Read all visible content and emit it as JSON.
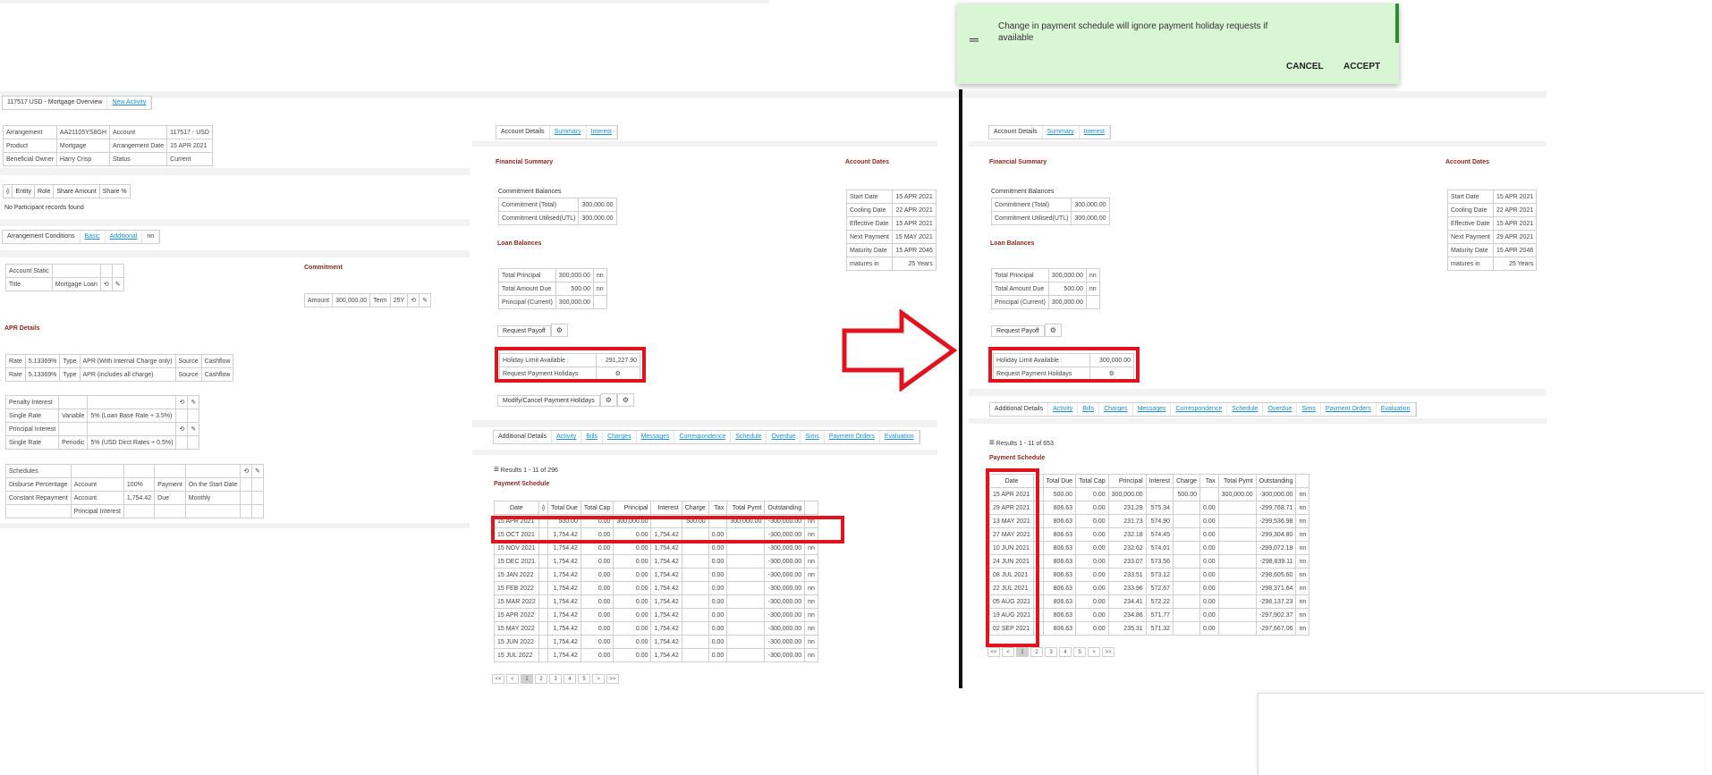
{
  "top_tabs": {
    "overview": "117517 USD - Mortgage Overview",
    "new_activity": "New Activity"
  },
  "arrangement": {
    "rows": [
      [
        "Arrangement",
        "AA21105YS8GH",
        "Account",
        "117517 - USD"
      ],
      [
        "Product",
        "Mortgage",
        "Arrangement Date",
        "15 APR 2021"
      ],
      [
        "Beneficial Owner",
        "Harry Crisp",
        "Status",
        "Current"
      ]
    ]
  },
  "participants": {
    "headers": [
      "Entity",
      "Role",
      "Share Amount",
      "Share %"
    ],
    "empty": "No Participant records found"
  },
  "conditions_tabs": {
    "label": "Arrangement Conditions",
    "basic": "Basic",
    "additional": "Additional",
    "more": "nn"
  },
  "account_static": {
    "title": "Account Static",
    "title_label": "Title",
    "title_value": "Mortgage Loan"
  },
  "commitment": {
    "title": "Commitment",
    "amount_label": "Amount",
    "amount": "300,000.00",
    "term_label": "Term",
    "term": "25Y"
  },
  "apr": {
    "title": "APR Details",
    "rows": [
      [
        "Rate",
        "5.13369%",
        "Type",
        "APR (With Internal Charge only)",
        "Source",
        "Cashflow"
      ],
      [
        "Rate",
        "5.13369%",
        "Type",
        "APR (includes all charge)",
        "Source",
        "Cashflow"
      ]
    ]
  },
  "penalty": {
    "rows": [
      [
        "Penalty Interest",
        "",
        ""
      ],
      [
        "Single Rate",
        "Variable",
        "5% (Loan Base Rate + 3.5%)"
      ],
      [
        "Principal Interest",
        "",
        ""
      ],
      [
        "Single Rate",
        "Periodic",
        "5% (USD Dirct Rates + 0.5%)"
      ]
    ]
  },
  "schedules": {
    "rows": [
      [
        "Schedules",
        "",
        "",
        "",
        ""
      ],
      [
        "Disburse Percentage",
        "Account",
        "100%",
        "Payment",
        "On the Start Date"
      ],
      [
        "Constant Repayment",
        "Account",
        "1,754.42",
        "Due",
        "Monthly"
      ],
      [
        "",
        "Principal Interest",
        "",
        "",
        ""
      ]
    ]
  },
  "left": {
    "tabs": {
      "details": "Account Details",
      "summary": "Summary",
      "interest": "Interest"
    },
    "fin_title": "Financial Summary",
    "dates_title": "Account Dates",
    "commit_bal_title": "Commitment Balances",
    "commit_rows": [
      [
        "Commitment (Total)",
        "300,000.00"
      ],
      [
        "Commitment Utilised(UTL)",
        "300,000.00"
      ]
    ],
    "loan_title": "Loan Balances",
    "loan_rows": [
      [
        "Total Principal",
        "300,000.00",
        "nn"
      ],
      [
        "Total Amount Due",
        "500.00",
        "nn"
      ],
      [
        "Principal (Current)",
        "300,000.00",
        ""
      ]
    ],
    "dates": [
      [
        "Start Date",
        "15 APR 2021"
      ],
      [
        "Cooling Date",
        "22 APR 2021"
      ],
      [
        "Effective Date",
        "15 APR 2021"
      ],
      [
        "Next Payment",
        "15 MAY 2021"
      ],
      [
        "Maturity Date",
        "15 APR 2046"
      ],
      [
        "matures in",
        "25 Years"
      ]
    ],
    "payoff": "Request Payoff",
    "holiday_limit_label": "Holiday Limit Available :",
    "holiday_limit_value": "291,227.90",
    "holiday_request": "Request Payment Holidays",
    "modify_holidays": "Modify/Cancel Payment Holidays",
    "add_tabs": [
      "Additional Details",
      "Activity",
      "Bills",
      "Charges",
      "Messages",
      "Correspondence",
      "Schedule",
      "Overdue",
      "Sims",
      "Payment Orders",
      "Evaluation"
    ],
    "results": "Results 1 - 11 of 296",
    "sched_title": "Payment Schedule",
    "sched_headers": [
      "Date",
      "",
      "Total Due",
      "Total Cap",
      "Principal",
      "Interest",
      "Charge",
      "Tax",
      "Total Pymt",
      "Outstanding",
      ""
    ],
    "sched_rows": [
      [
        "15 APR 2021",
        "",
        "500.00",
        "0.00",
        "300,000.00",
        "",
        "500.00",
        "",
        "300,000.00",
        "-300,000.00",
        "nn"
      ],
      [
        "15 OCT 2021",
        "",
        "1,754.42",
        "0.00",
        "0.00",
        "1,754.42",
        "",
        "0.00",
        "",
        "-300,000.00",
        "nn"
      ],
      [
        "15 NOV 2021",
        "",
        "1,754.42",
        "0.00",
        "0.00",
        "1,754.42",
        "",
        "0.00",
        "",
        "-300,000.00",
        "nn"
      ],
      [
        "15 DEC 2021",
        "",
        "1,754.42",
        "0.00",
        "0.00",
        "1,754.42",
        "",
        "0.00",
        "",
        "-300,000.00",
        "nn"
      ],
      [
        "15 JAN 2022",
        "",
        "1,754.42",
        "0.00",
        "0.00",
        "1,754.42",
        "",
        "0.00",
        "",
        "-300,000.00",
        "nn"
      ],
      [
        "15 FEB 2022",
        "",
        "1,754.42",
        "0.00",
        "0.00",
        "1,754.42",
        "",
        "0.00",
        "",
        "-300,000.00",
        "nn"
      ],
      [
        "15 MAR 2022",
        "",
        "1,754.42",
        "0.00",
        "0.00",
        "1,754.42",
        "",
        "0.00",
        "",
        "-300,000.00",
        "nn"
      ],
      [
        "15 APR 2022",
        "",
        "1,754.42",
        "0.00",
        "0.00",
        "1,754.42",
        "",
        "0.00",
        "",
        "-300,000.00",
        "nn"
      ],
      [
        "15 MAY 2022",
        "",
        "1,754.42",
        "0.00",
        "0.00",
        "1,754.42",
        "",
        "0.00",
        "",
        "-300,000.00",
        "nn"
      ],
      [
        "15 JUN 2022",
        "",
        "1,754.42",
        "0.00",
        "0.00",
        "1,754.42",
        "",
        "0.00",
        "",
        "-300,000.00",
        "nn"
      ],
      [
        "15 JUL 2022",
        "",
        "1,754.42",
        "0.00",
        "0.00",
        "1,754.42",
        "",
        "0.00",
        "",
        "-300,000.00",
        "nn"
      ]
    ],
    "pages": [
      "<<",
      "<",
      "1",
      "2",
      "3",
      "4",
      "5",
      ">",
      ">>"
    ]
  },
  "right": {
    "dates": [
      [
        "Start Date",
        "15 APR 2021"
      ],
      [
        "Cooling Date",
        "22 APR 2021"
      ],
      [
        "Effective Date",
        "15 APR 2021"
      ],
      [
        "Next Payment",
        "29 APR 2021"
      ],
      [
        "Maturity Date",
        "15 APR 2046"
      ],
      [
        "matures in",
        "25 Years"
      ]
    ],
    "holiday_limit_value": "300,000.00",
    "results": "Results 1 - 11 of 653",
    "sched_headers": [
      "Date",
      "",
      "Total Due",
      "Total Cap",
      "Principal",
      "Interest",
      "Charge",
      "Tax",
      "Total Pymt",
      "Outstanding",
      ""
    ],
    "sched_rows": [
      [
        "15 APR 2021",
        "",
        "500.00",
        "0.00",
        "300,000.00",
        "",
        "500.00",
        "",
        "300,000.00",
        "-300,000.00",
        "nn"
      ],
      [
        "29 APR 2021",
        "",
        "806.63",
        "0.00",
        "231.29",
        "575.34",
        "",
        "0.00",
        "",
        "-299,768.71",
        "nn"
      ],
      [
        "13 MAY 2021",
        "",
        "806.63",
        "0.00",
        "231.73",
        "574.90",
        "",
        "0.00",
        "",
        "-299,536.98",
        "nn"
      ],
      [
        "27 MAY 2021",
        "",
        "806.63",
        "0.00",
        "232.18",
        "574.45",
        "",
        "0.00",
        "",
        "-299,304.80",
        "nn"
      ],
      [
        "10 JUN 2021",
        "",
        "806.63",
        "0.00",
        "232.62",
        "574.01",
        "",
        "0.00",
        "",
        "-299,072.18",
        "nn"
      ],
      [
        "24 JUN 2021",
        "",
        "806.63",
        "0.00",
        "233.07",
        "573.56",
        "",
        "0.00",
        "",
        "-298,839.11",
        "nn"
      ],
      [
        "08 JUL 2021",
        "",
        "806.63",
        "0.00",
        "233.51",
        "573.12",
        "",
        "0.00",
        "",
        "-298,605.60",
        "nn"
      ],
      [
        "22 JUL 2021",
        "",
        "806.63",
        "0.00",
        "233.96",
        "572.67",
        "",
        "0.00",
        "",
        "-298,371.64",
        "nn"
      ],
      [
        "05 AUG 2021",
        "",
        "806.63",
        "0.00",
        "234.41",
        "572.22",
        "",
        "0.00",
        "",
        "-298,137.23",
        "nn"
      ],
      [
        "19 AUG 2021",
        "",
        "806.63",
        "0.00",
        "234.86",
        "571.77",
        "",
        "0.00",
        "",
        "-297,902.37",
        "nn"
      ],
      [
        "02 SEP 2021",
        "",
        "806.63",
        "0.00",
        "235.31",
        "571.32",
        "",
        "0.00",
        "",
        "-297,667.06",
        "nn"
      ]
    ]
  },
  "dialog": {
    "message": "Change in payment schedule will ignore payment holiday requests if available",
    "cancel": "CANCEL",
    "accept": "ACCEPT"
  },
  "colors": {
    "accent_red": "#e0141e",
    "link": "#1a8fd1",
    "section_title": "#8b2a1e",
    "dialog_bg": "#d8f5d4",
    "dialog_bar": "#2e8b2e"
  }
}
